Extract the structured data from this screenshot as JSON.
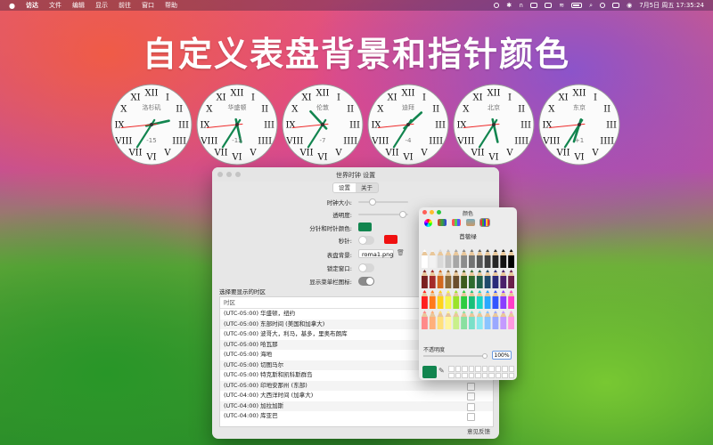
{
  "menubar": {
    "app": "访达",
    "items": [
      "文件",
      "编辑",
      "显示",
      "前往",
      "窗口",
      "帮助"
    ],
    "clock": "7月5日 周五  17:35:24"
  },
  "headline": "自定义表盘背景和指针颜色",
  "clocks": [
    {
      "city": "洛杉矶",
      "offset": "-15",
      "hour": 2,
      "minute": 35,
      "second": 24
    },
    {
      "city": "华盛顿",
      "offset": "-12",
      "hour": 5,
      "minute": 35,
      "second": 24
    },
    {
      "city": "伦敦",
      "offset": "-7",
      "hour": 10,
      "minute": 35,
      "second": 24
    },
    {
      "city": "迪拜",
      "offset": "-4",
      "hour": 1,
      "minute": 35,
      "second": 24
    },
    {
      "city": "北京",
      "offset": "",
      "hour": 5,
      "minute": 35,
      "second": 24
    },
    {
      "city": "东京",
      "offset": "+1",
      "hour": 6,
      "minute": 35,
      "second": 24
    }
  ],
  "clock_style": {
    "numerals": [
      "XII",
      "I",
      "II",
      "III",
      "IIII",
      "V",
      "VI",
      "VII",
      "VIII",
      "IX",
      "X",
      "XI"
    ],
    "hand_color": "#12854f",
    "second_color": "#ee2a2a"
  },
  "settings": {
    "title": "世界时钟 设置",
    "tabs": [
      "设置",
      "关于"
    ],
    "active_tab": 0,
    "clock_size_label": "时钟大小:",
    "clock_size_value": 0.25,
    "transparency_label": "透明度:",
    "transparency_value": 0.95,
    "hand_color_label": "分针和时针颜色:",
    "hand_color": "#12854f",
    "second_hand_label": "秒针:",
    "second_color": "#f01010",
    "second_enabled": false,
    "face_bg_label": "表盘背景:",
    "face_bg_file": "roma1.png",
    "lock_label": "锁定窗口:",
    "lock_enabled": false,
    "menubar_icon_label": "显示菜单栏图标:",
    "menubar_icon_enabled": true,
    "tz_section_title": "选择要显示的时区",
    "tz_column": "时区",
    "timezones": [
      "(UTC-05:00) 华盛顿，纽约",
      "(UTC-05:00) 东部时间 (美国和加拿大)",
      "(UTC-05:00) 波哥大，利马，基多，里奥布朗库",
      "(UTC-05:00) 哈瓦那",
      "(UTC-05:00) 海地",
      "(UTC-05:00) 切图马尔",
      "(UTC-05:00) 特克斯和凯科斯群岛",
      "(UTC-05:00) 印地安那州 (东部)",
      "(UTC-04:00) 大西洋时间 (加拿大)",
      "(UTC-04:00) 加拉加斯",
      "(UTC-04:00) 库亚巴"
    ],
    "feedback": "意见反馈"
  },
  "color_panel": {
    "title": "颜色",
    "selected_name": "苜蓿绿",
    "opacity_label": "不透明度",
    "opacity_value": "100%",
    "opacity_fraction": 1.0,
    "current_color": "#12854f",
    "pencil_colors": [
      "#ffffff",
      "#f2f2f2",
      "#d9d9d9",
      "#bfbfbf",
      "#a6a6a6",
      "#8c8c8c",
      "#737373",
      "#595959",
      "#404040",
      "#262626",
      "#111111",
      "#000000",
      "#7a1f1f",
      "#a52a2a",
      "#d2691e",
      "#8b6b3a",
      "#6b4e2e",
      "#3d5c1e",
      "#2e6b2e",
      "#1f5f4a",
      "#1f4a6b",
      "#2a2a7a",
      "#4a1f6b",
      "#6b1f4a",
      "#ff2020",
      "#ff7a1a",
      "#ffd21a",
      "#f5f54a",
      "#9be32a",
      "#2ecc40",
      "#18c07a",
      "#1ad6c6",
      "#2aa8ff",
      "#3355ff",
      "#8a3dff",
      "#ff3dc8",
      "#ff8a8a",
      "#ffb07a",
      "#ffe07a",
      "#fff5a0",
      "#c9f08a",
      "#8ae0a0",
      "#7ae0c8",
      "#8ae8f0",
      "#8ac4ff",
      "#9aa8ff",
      "#c49aff",
      "#ff9ae0"
    ]
  }
}
